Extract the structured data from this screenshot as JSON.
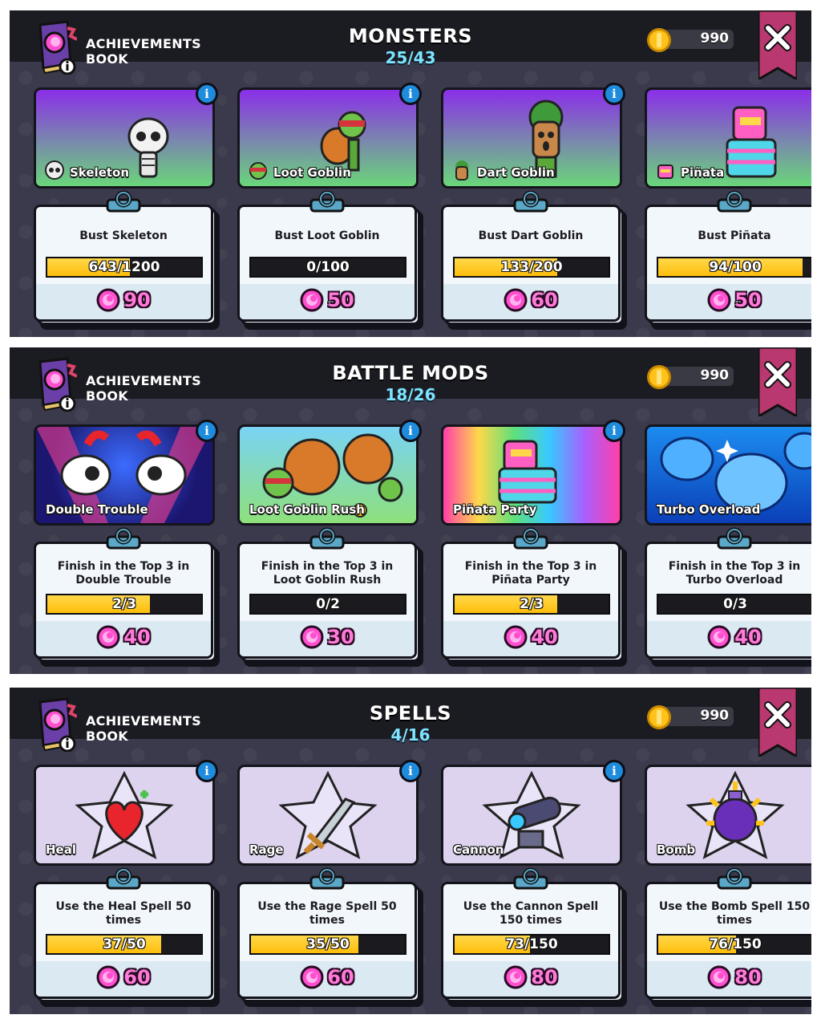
{
  "book_title_line1": "ACHIEVEMENTS",
  "book_title_line2": "BOOK",
  "book_icon": "achievements-book-icon",
  "close_icon": "close-icon",
  "coin_icon": "gold-coin-icon",
  "gem_icon": "pink-gem-icon",
  "colors": {
    "topbar": "#1b1b22",
    "panel": "#3b3a4c",
    "progress_fill": "#ffc61a",
    "counter": "#7de3ff",
    "reward": "#ff7ad9",
    "close_ribbon": "#b8386f"
  },
  "panels": [
    {
      "title": "MONSTERS",
      "count": "25/43",
      "coins": "990",
      "cards": [
        {
          "name": "Skeleton",
          "task": "Bust Skeleton",
          "progress": "643/1200",
          "fraction": 0.536,
          "reward": "90"
        },
        {
          "name": "Loot Goblin",
          "task": "Bust Loot Goblin",
          "progress": "0/100",
          "fraction": 0,
          "reward": "50"
        },
        {
          "name": "Dart Goblin",
          "task": "Bust Dart Goblin",
          "progress": "133/200",
          "fraction": 0.665,
          "reward": "60"
        },
        {
          "name": "Piñata",
          "task": "Bust Piñata",
          "progress": "94/100",
          "fraction": 0.94,
          "reward": "50"
        }
      ]
    },
    {
      "title": "BATTLE MODS",
      "count": "18/26",
      "coins": "990",
      "cards": [
        {
          "name": "Double Trouble",
          "task": "Finish in the Top 3 in Double Trouble",
          "progress": "2/3",
          "fraction": 0.667,
          "reward": "40"
        },
        {
          "name": "Loot Goblin Rush",
          "task": "Finish in the Top 3 in Loot Goblin Rush",
          "progress": "0/2",
          "fraction": 0,
          "reward": "30"
        },
        {
          "name": "Piñata Party",
          "task": "Finish in the Top 3 in Piñata Party",
          "progress": "2/3",
          "fraction": 0.667,
          "reward": "40"
        },
        {
          "name": "Turbo Overload",
          "task": "Finish in the Top 3 in Turbo Overload",
          "progress": "0/3",
          "fraction": 0,
          "reward": "40"
        }
      ]
    },
    {
      "title": "SPELLS",
      "count": "4/16",
      "coins": "990",
      "cards": [
        {
          "name": "Heal",
          "task": "Use the Heal Spell 50 times",
          "progress": "37/50",
          "fraction": 0.74,
          "reward": "60"
        },
        {
          "name": "Rage",
          "task": "Use the Rage Spell 50 times",
          "progress": "35/50",
          "fraction": 0.7,
          "reward": "60"
        },
        {
          "name": "Cannon",
          "task": "Use the Cannon Spell 150 times",
          "progress": "73/150",
          "fraction": 0.487,
          "reward": "80"
        },
        {
          "name": "Bomb",
          "task": "Use the Bomb Spell 150 times",
          "progress": "76/150",
          "fraction": 0.507,
          "reward": "80"
        }
      ]
    }
  ]
}
